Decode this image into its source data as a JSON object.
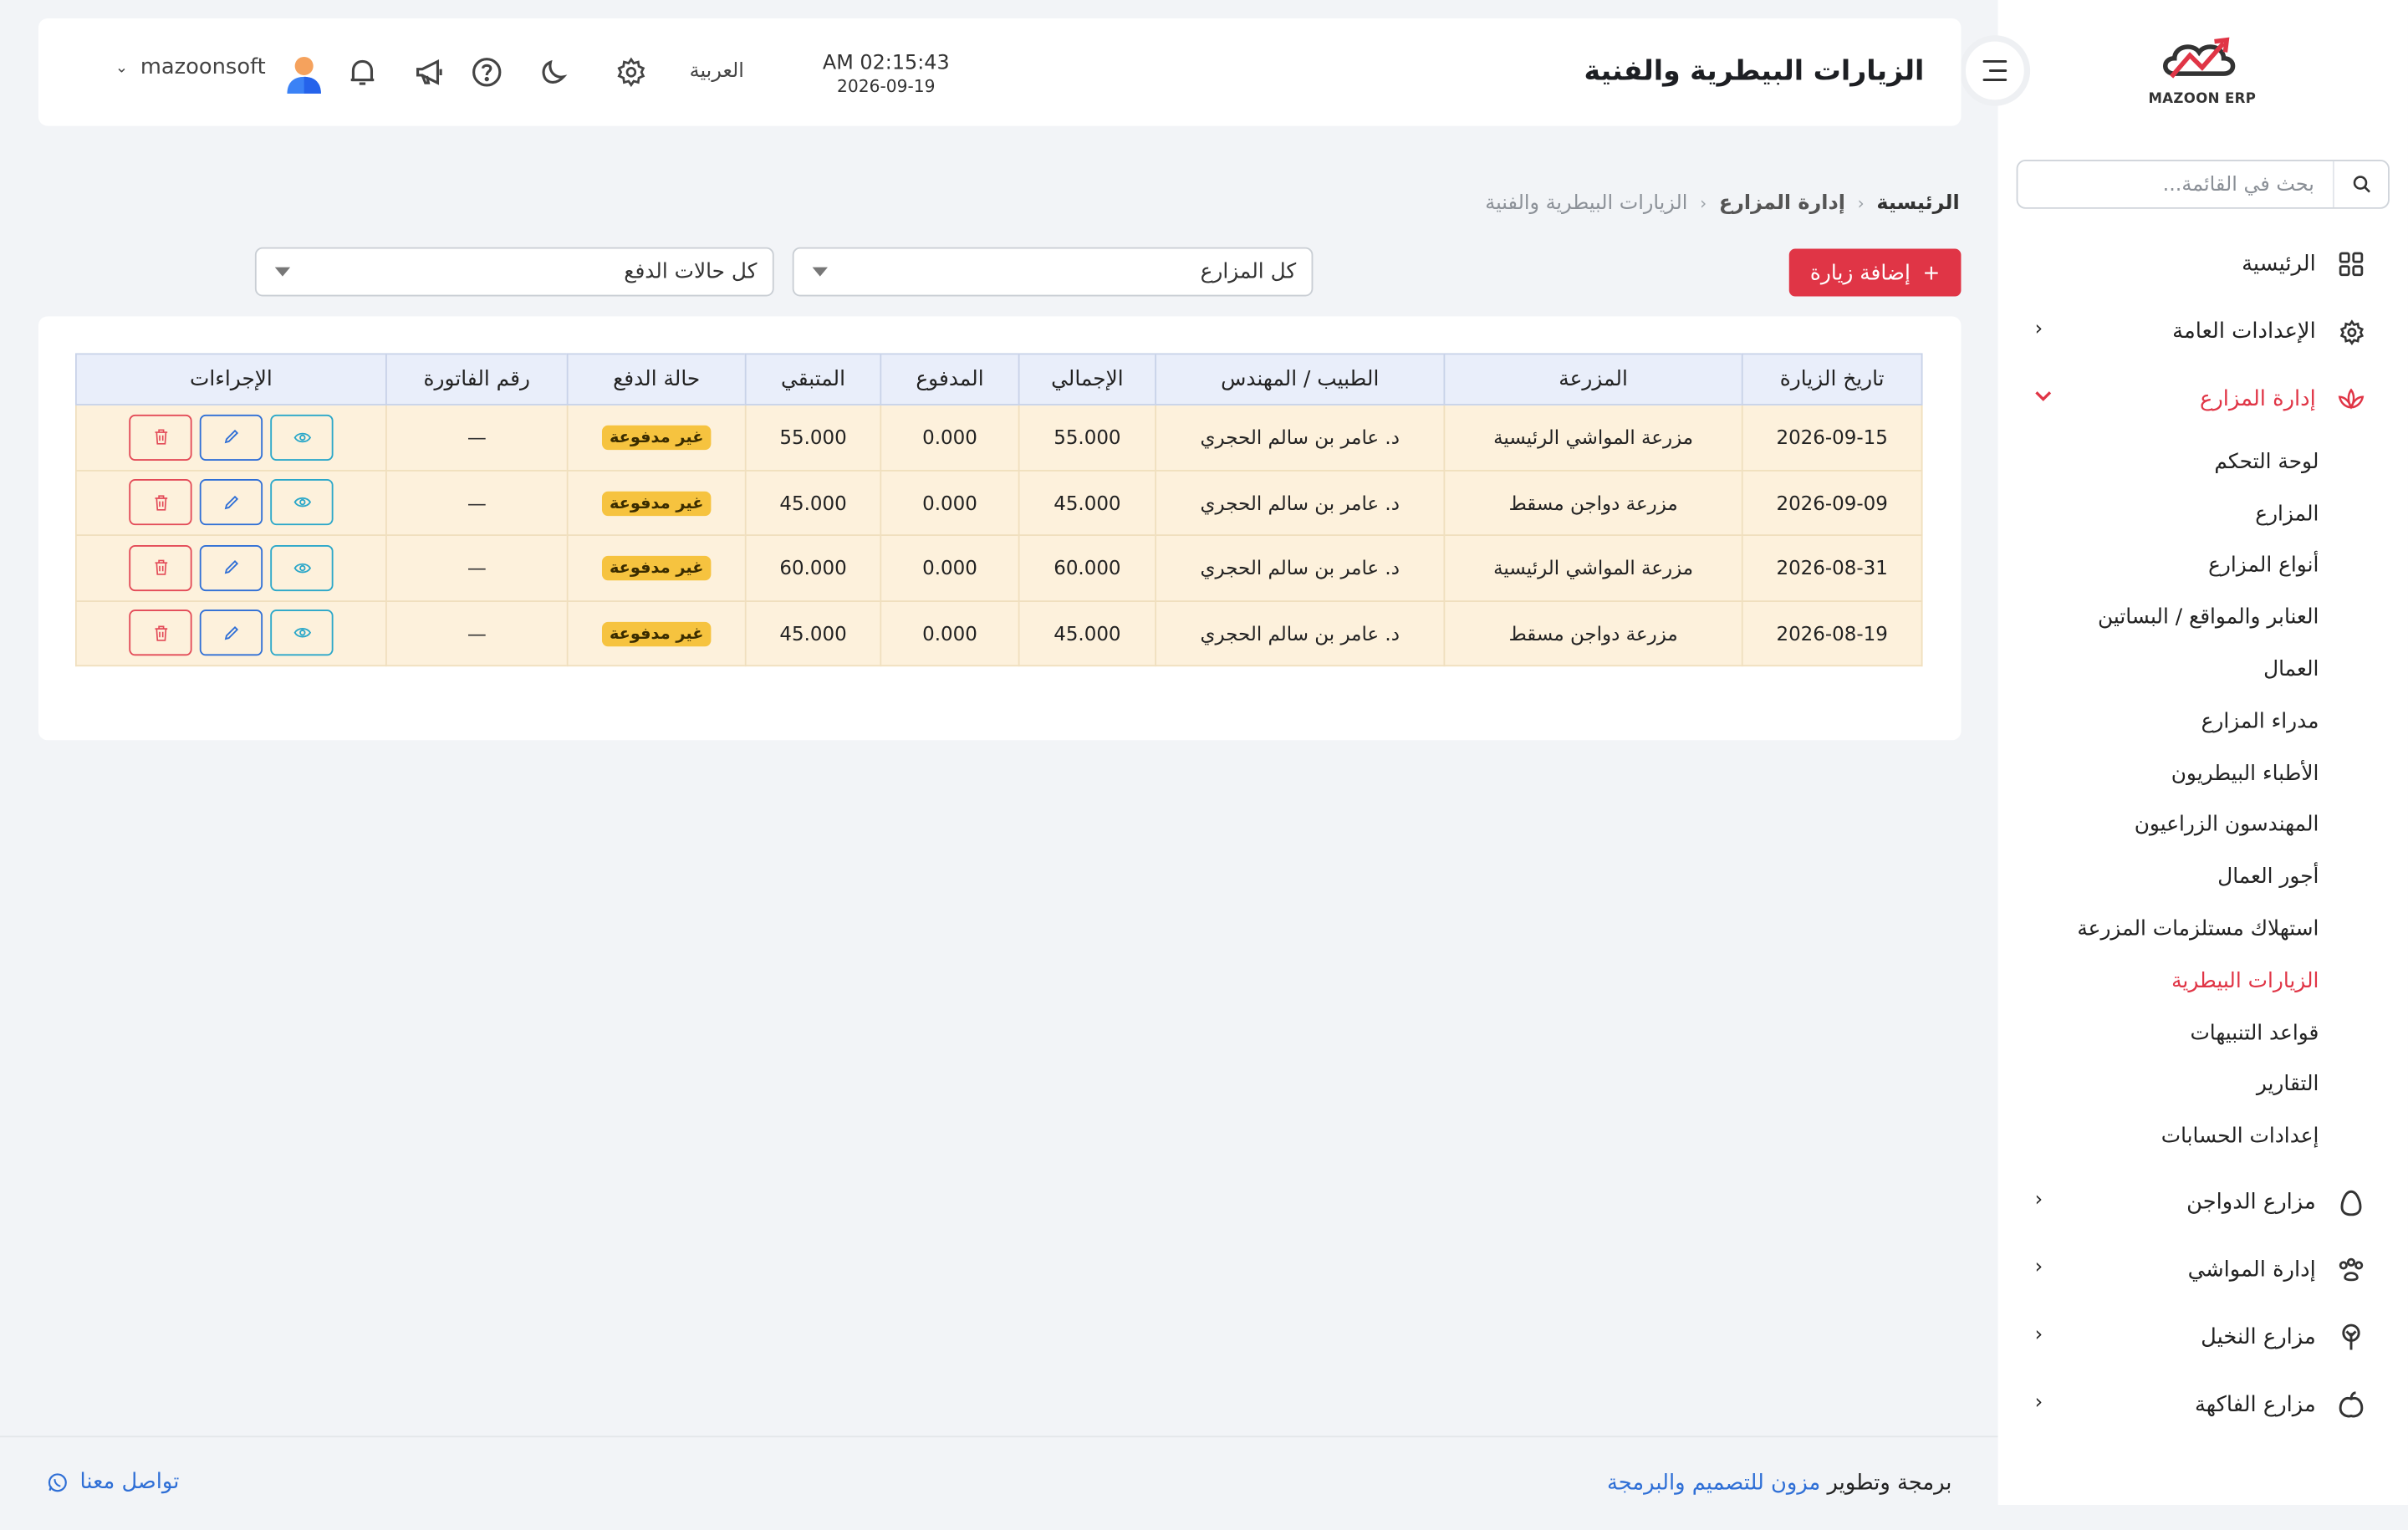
{
  "brand": {
    "logo_text": "MAZOON ERP",
    "accent": "#e03546"
  },
  "header": {
    "title": "الزيارات البيطرية والفنية",
    "time": "AM 02:15:43",
    "date": "2026-09-19",
    "language": "العربية",
    "username": "mazoonsoft",
    "icons": [
      "gear-icon",
      "moon-icon",
      "help-icon",
      "megaphone-icon",
      "bell-icon"
    ]
  },
  "sidebar": {
    "search_placeholder": "بحث في القائمة...",
    "items": [
      {
        "label": "الرئيسية",
        "icon": "grid-icon"
      },
      {
        "label": "الإعدادات العامة",
        "icon": "gear-icon"
      },
      {
        "label": "إدارة المزارع",
        "icon": "lotus-icon"
      },
      {
        "label": "مزارع الدواجن",
        "icon": "egg-icon"
      },
      {
        "label": "إدارة المواشي",
        "icon": "paw-icon"
      },
      {
        "label": "مزارع النخيل",
        "icon": "palm-icon"
      },
      {
        "label": "مزارع الفاكهة",
        "icon": "fruit-icon"
      }
    ],
    "submenu": [
      "لوحة التحكم",
      "المزارع",
      "أنواع المزارع",
      "العنابر والمواقع / البساتين",
      "العمال",
      "مدراء المزارع",
      "الأطباء البيطريون",
      "المهندسون الزراعيون",
      "أجور العمال",
      "استهلاك مستلزمات المزرعة",
      "الزيارات البيطرية",
      "قواعد التنبيهات",
      "التقارير",
      "إعدادات الحسابات"
    ]
  },
  "breadcrumb": {
    "home": "الرئيسية",
    "section": "إدارة المزارع",
    "current": "الزيارات البيطرية والفنية"
  },
  "toolbar": {
    "add_label": "إضافة زيارة",
    "farm_filter": "كل المزارع",
    "payment_filter": "كل حالات الدفع"
  },
  "table": {
    "columns": [
      "تاريخ الزيارة",
      "المزرعة",
      "الطبيب / المهندس",
      "الإجمالي",
      "المدفوع",
      "المتبقي",
      "حالة الدفع",
      "رقم الفاتورة",
      "الإجراءات"
    ],
    "rows": [
      {
        "date": "2026-09-15",
        "farm": "مزرعة المواشي الرئيسية",
        "doctor": "د. عامر بن سالم الحجري",
        "total": "55.000",
        "paid": "0.000",
        "remaining": "55.000",
        "status": "غير مدفوعة",
        "invoice": "—"
      },
      {
        "date": "2026-09-09",
        "farm": "مزرعة دواجن مسقط",
        "doctor": "د. عامر بن سالم الحجري",
        "total": "45.000",
        "paid": "0.000",
        "remaining": "45.000",
        "status": "غير مدفوعة",
        "invoice": "—"
      },
      {
        "date": "2026-08-31",
        "farm": "مزرعة المواشي الرئيسية",
        "doctor": "د. عامر بن سالم الحجري",
        "total": "60.000",
        "paid": "0.000",
        "remaining": "60.000",
        "status": "غير مدفوعة",
        "invoice": "—"
      },
      {
        "date": "2026-08-19",
        "farm": "مزرعة دواجن مسقط",
        "doctor": "د. عامر بن سالم الحجري",
        "total": "45.000",
        "paid": "0.000",
        "remaining": "45.000",
        "status": "غير مدفوعة",
        "invoice": "—"
      }
    ]
  },
  "footer": {
    "credit_prefix": "برمجة وتطوير",
    "credit_link": "مزون للتصميم والبرمجة",
    "contact": "تواصل معنا"
  }
}
